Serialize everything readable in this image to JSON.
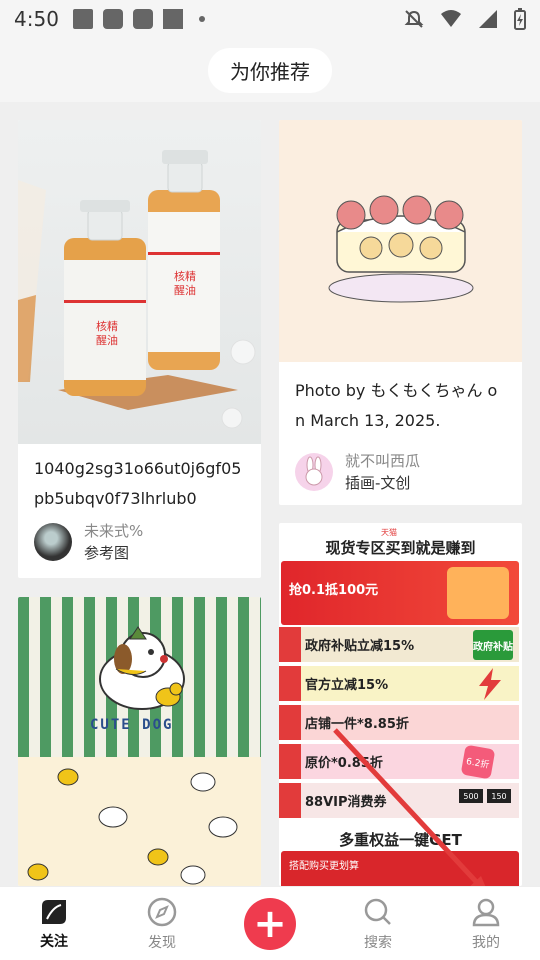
{
  "status": {
    "time": "4:50"
  },
  "header": {
    "title": "为你推荐"
  },
  "cards": [
    {
      "title": "1040g2sg31o66ut0j6gf05pb5ubqv0f73lhrlub0",
      "author": "未来式%",
      "tag": "参考图"
    },
    {
      "title": "Photo by もくもくちゃん on March 13, 2025.",
      "author": "就不叫西瓜",
      "tag": "插画-文创"
    }
  ],
  "promo": {
    "brand": "天猫",
    "heading": "现货专区买到就是赚到",
    "top_line": "抢0.1抵100元",
    "rows": [
      "政府补贴立减15%",
      "官方立减15%",
      "店铺一件*8.85折",
      "原价*0.85折",
      "88VIP消费券"
    ],
    "badge": "政府补贴",
    "footer": "多重权益一键GET",
    "footer2": "搭配购买更划算",
    "coupon_500": "500",
    "coupon_150": "150",
    "discount": "6.2折"
  },
  "cute_dog": {
    "brand_text": "CUTE DOG"
  },
  "nav": {
    "items": [
      {
        "label": "关注",
        "icon": "follow-icon",
        "active": true
      },
      {
        "label": "发现",
        "icon": "compass-icon",
        "active": false
      },
      {
        "label": "",
        "icon": "plus-icon",
        "active": false
      },
      {
        "label": "搜索",
        "icon": "search-icon",
        "active": false
      },
      {
        "label": "我的",
        "icon": "profile-icon",
        "active": false
      }
    ]
  },
  "colors": {
    "accent": "#ef3b4e",
    "promo_red": "#e23b3b",
    "stripe_green": "#4e9a62"
  }
}
